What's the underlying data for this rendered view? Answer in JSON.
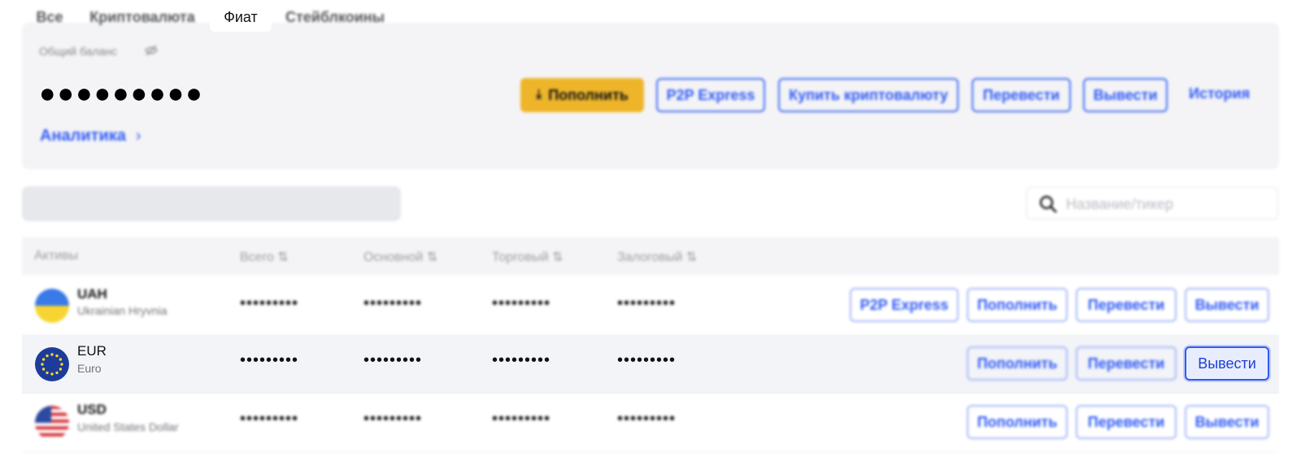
{
  "balance": {
    "label": "Общий баланс",
    "visibility_icon": "eye-off-icon",
    "masked_value": "●●●●●●●●●",
    "analytics_link": "Аналитика",
    "actions": {
      "deposit": "Пополнить",
      "p2p": "P2P Express",
      "buy_crypto": "Купить криптовалюту",
      "transfer": "Перевести",
      "withdraw": "Вывести",
      "history": "История"
    }
  },
  "filters": {
    "tabs": [
      "Все",
      "Криптовалюта",
      "Фиат",
      "Стейблкоины"
    ],
    "active_tab": "Фиат"
  },
  "search": {
    "placeholder": "Название/тикер"
  },
  "table": {
    "headers": [
      "Активы",
      "Всего",
      "Основной",
      "Торговый",
      "Залоговый"
    ],
    "rows": [
      {
        "code": "UAH",
        "name": "Ukrainian Hryvnia",
        "total": "•••••••••",
        "main": "•••••••••",
        "trading": "•••••••••",
        "collateral": "•••••••••",
        "actions": [
          "P2P Express",
          "Пополнить",
          "Перевести",
          "Вывести"
        ]
      },
      {
        "code": "EUR",
        "name": "Euro",
        "total": "•••••••••",
        "main": "•••••••••",
        "trading": "•••••••••",
        "collateral": "•••••••••",
        "actions": [
          "Пополнить",
          "Перевести",
          "Вывести"
        ]
      },
      {
        "code": "USD",
        "name": "United States Dollar",
        "total": "•••••••••",
        "main": "•••••••••",
        "trading": "•••••••••",
        "collateral": "•••••••••",
        "actions": [
          "Пополнить",
          "Перевести",
          "Вывести"
        ]
      }
    ]
  },
  "colors": {
    "accent": "#2f5af5",
    "primary_button": "#eeb52a"
  }
}
